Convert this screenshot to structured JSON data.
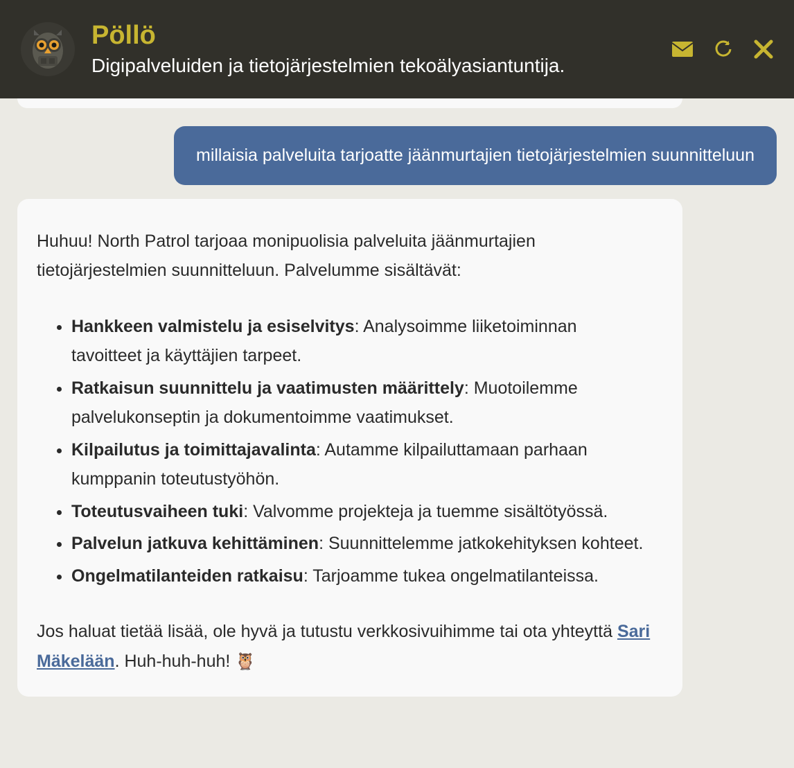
{
  "header": {
    "title": "Pöllö",
    "subtitle": "Digipalveluiden ja tietojärjestelmien tekoälyasiantuntija."
  },
  "user_message": "millaisia palveluita tarjoatte jäänmurtajien tietojärjestelmien suunnitteluun",
  "assistant": {
    "intro": "Huhuu! North Patrol tarjoaa monipuolisia palveluita jäänmurtajien tietojärjestelmien suunnitteluun. Palvelumme sisältävät:",
    "items": [
      {
        "bold": "Hankkeen valmistelu ja esiselvitys",
        "rest": ": Analysoimme liiketoiminnan tavoitteet ja käyttäjien tarpeet."
      },
      {
        "bold": "Ratkaisun suunnittelu ja vaatimusten määrittely",
        "rest": ": Muotoilemme palvelukonseptin ja dokumentoimme vaatimukset."
      },
      {
        "bold": "Kilpailutus ja toimittajavalinta",
        "rest": ": Autamme kilpailuttamaan parhaan kumppanin toteutustyöhön."
      },
      {
        "bold": "Toteutusvaiheen tuki",
        "rest": ": Valvomme projekteja ja tuemme sisältötyössä."
      },
      {
        "bold": "Palvelun jatkuva kehittäminen",
        "rest": ": Suunnittelemme jatkokehityksen kohteet."
      },
      {
        "bold": "Ongelmatilanteiden ratkaisu",
        "rest": ": Tarjoamme tukea ongelmatilanteissa."
      }
    ],
    "outro_before_link": "Jos haluat tietää lisää, ole hyvä ja tutustu verkkosivuihimme tai ota yhteyttä ",
    "link_text": "Sari Mäkelään",
    "outro_after_link": ". Huh-huh-huh! ",
    "emoji": "🦉"
  },
  "colors": {
    "accent": "#c7b531",
    "header_bg": "#31302a",
    "user_bubble": "#4a6a9a",
    "assistant_bubble": "#f9f9f9",
    "page_bg": "#ebeae4"
  }
}
